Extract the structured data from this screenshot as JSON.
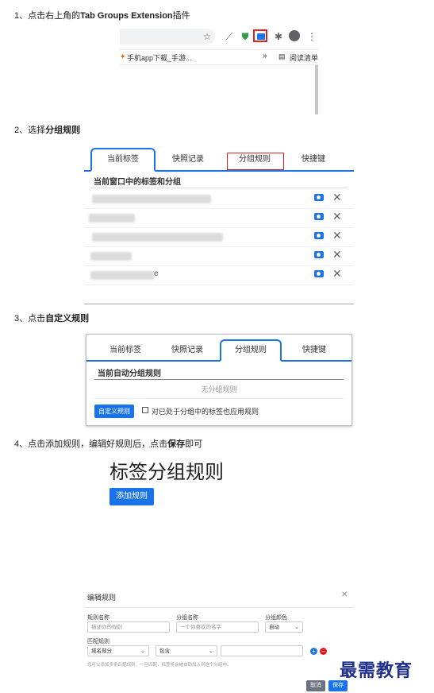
{
  "steps": [
    {
      "prefix": "1、点击右上角的",
      "bold": "Tab Groups Extension",
      "suffix": "插件"
    },
    {
      "prefix": "2、选择",
      "bold": "分组规则",
      "suffix": ""
    },
    {
      "prefix": "3、点击",
      "bold": "自定义规则",
      "suffix": ""
    },
    {
      "prefix": "4、点击添加规则，编辑好规则后，点击",
      "bold": "保存",
      "suffix": "即可"
    }
  ],
  "browser": {
    "bookmark1": "手机app下载_手游...",
    "more": "»",
    "reading_list": "阅读清单"
  },
  "tabs": {
    "current": "当前标签",
    "snapshot": "快照记录",
    "group_rules": "分组规则",
    "shortcuts": "快捷键"
  },
  "panel1": {
    "section_title": "当前窗口中的标签和分组",
    "rows": [
      {
        "text": "",
        "suffix": ""
      },
      {
        "text": "",
        "suffix": ""
      },
      {
        "text": "",
        "suffix": ""
      },
      {
        "text": "",
        "suffix": ""
      },
      {
        "text": "",
        "suffix": "e"
      }
    ]
  },
  "panel2": {
    "section_title": "当前自动分组规则",
    "empty": "无分组规则",
    "custom_button": "自定义规则",
    "checkbox_label": "对已处于分组中的标签也应用规则"
  },
  "rules_page": {
    "title": "标签分组规则",
    "add_button": "添加规则"
  },
  "dialog": {
    "title": "编辑规则",
    "close": "✕",
    "rule_name_label": "规则名称",
    "rule_name_placeholder": "描述你的规则",
    "group_name_label": "分组名称",
    "group_name_placeholder": "一个你喜欢的名字",
    "group_color_label": "分组颜色",
    "group_color_value": "自动",
    "match_label": "匹配规则",
    "match_field_value": "域名部分",
    "match_op_value": "包含",
    "hint": "您可以添加多条匹配规则，一旦匹配，标签将会被自动加入到这个分组中。",
    "cancel": "取消",
    "save": "保存"
  },
  "watermark": "最需教育",
  "colors": {
    "accent": "#1a73e8",
    "highlight": "#e02020",
    "watermark": "#1f2f8a"
  }
}
